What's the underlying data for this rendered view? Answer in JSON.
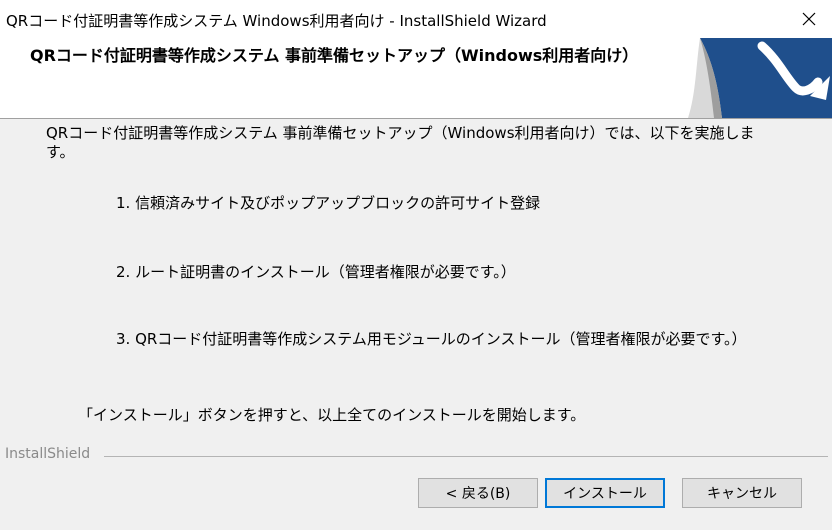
{
  "window": {
    "title": "QRコード付証明書等作成システム Windows利用者向け - InstallShield Wizard"
  },
  "banner": {
    "heading": "QRコード付証明書等作成システム 事前準備セットアップ（Windows利用者向け）"
  },
  "content": {
    "intro": "QRコード付証明書等作成システム 事前準備セットアップ（Windows利用者向け）では、以下を実施します。",
    "steps": [
      "1. 信頼済みサイト及びポップアップブロックの許可サイト登録",
      "2. ルート証明書のインストール（管理者権限が必要です。）",
      "3. QRコード付証明書等作成システム用モジュールのインストール（管理者権限が必要です。）"
    ],
    "note": "「インストール」ボタンを押すと、以上全てのインストールを開始します。"
  },
  "footer": {
    "brand": "InstallShield",
    "back_label": "< 戻る(B)",
    "install_label": "インストール",
    "cancel_label": "キャンセル"
  },
  "icons": {
    "close": "close-icon",
    "banner_graphic": "installshield-page-curl-graphic"
  },
  "colors": {
    "banner_blue": "#1f4f8c",
    "focus_border": "#0078d7",
    "dialog_bg": "#f0f0f0"
  }
}
